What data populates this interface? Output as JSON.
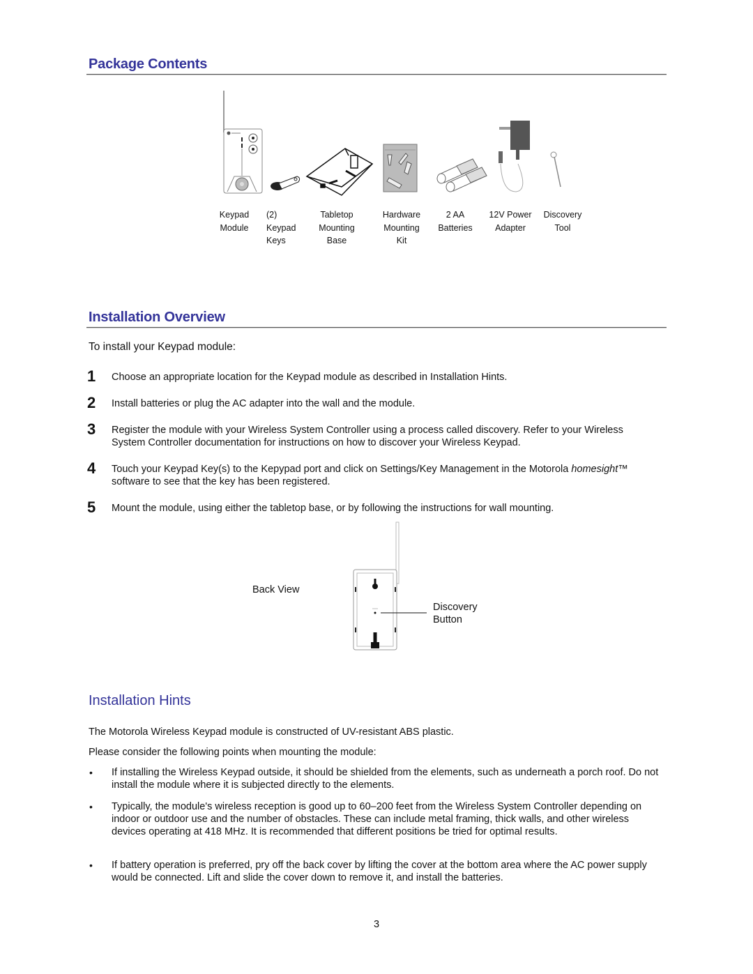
{
  "sections": {
    "package_contents": {
      "title": "Package Contents",
      "items": [
        {
          "icon": "keypad-module-icon",
          "label_lines": [
            "Keypad",
            "Module",
            ""
          ]
        },
        {
          "icon": "keypad-keys-icon",
          "label_lines": [
            "(2)",
            "Keypad",
            "Keys"
          ]
        },
        {
          "icon": "tabletop-base-icon",
          "label_lines": [
            "Tabletop",
            "Mounting",
            "Base"
          ]
        },
        {
          "icon": "hardware-kit-icon",
          "label_lines": [
            "Hardware",
            "Mounting",
            "Kit"
          ]
        },
        {
          "icon": "batteries-icon",
          "label_lines": [
            "2 AA",
            "Batteries",
            ""
          ]
        },
        {
          "icon": "power-adapter-icon",
          "label_lines": [
            "12V Power",
            "Adapter",
            ""
          ]
        },
        {
          "icon": "discovery-tool-icon",
          "label_lines": [
            "Discovery",
            "Tool",
            ""
          ]
        }
      ]
    },
    "installation_overview": {
      "title": "Installation Overview",
      "intro": "To install your Keypad module:",
      "steps": [
        {
          "num": "1",
          "text": "Choose an appropriate location for the Keypad module as described in Installation Hints."
        },
        {
          "num": "2",
          "text": "Install batteries or plug the AC adapter into the wall and the module."
        },
        {
          "num": "3",
          "text": "Register the module with your Wireless System Controller using a process called discovery. Refer to your Wireless System Controller documentation for instructions on how to discover your Wireless Keypad."
        },
        {
          "num": "4",
          "text_before": "Touch your Keypad Key(s) to the Kepypad port and click on Settings/Key Management in the Motorola ",
          "text_italic": "homesight",
          "text_after": "™ software to see that the key has been registered."
        },
        {
          "num": "5",
          "text": "Mount the module, using either the tabletop base, or by following the instructions for wall mounting."
        }
      ],
      "figure": {
        "label": "Back View",
        "callout_line1": "Discovery",
        "callout_line2": "Button"
      }
    },
    "installation_hints": {
      "title": "Installation Hints",
      "para1": "The Motorola Wireless Keypad module is constructed of UV-resistant ABS plastic.",
      "para2": "Please consider the following points when mounting the module:",
      "bullet_glyph": "•",
      "bullets": [
        "If installing the Wireless Keypad outside, it should be shielded from the elements, such as underneath a porch roof. Do not install the module where it is subjected directly to the elements.",
        "Typically, the module's wireless reception is good up to 60–200 feet from the Wireless System Controller depending on indoor or outdoor use and the number of obstacles. These can include metal framing, thick walls, and other wireless devices operating at 418 MHz. It is recommended that different positions be tried for optimal results.",
        "If battery operation is preferred, pry off the back cover by lifting the cover at the bottom area where the AC power supply would be connected. Lift and slide the cover down to remove it, and install the batteries."
      ]
    }
  },
  "footer": {
    "page_number": "3"
  },
  "colors": {
    "heading": "#333399",
    "rule": "#555555",
    "text": "#111111"
  }
}
